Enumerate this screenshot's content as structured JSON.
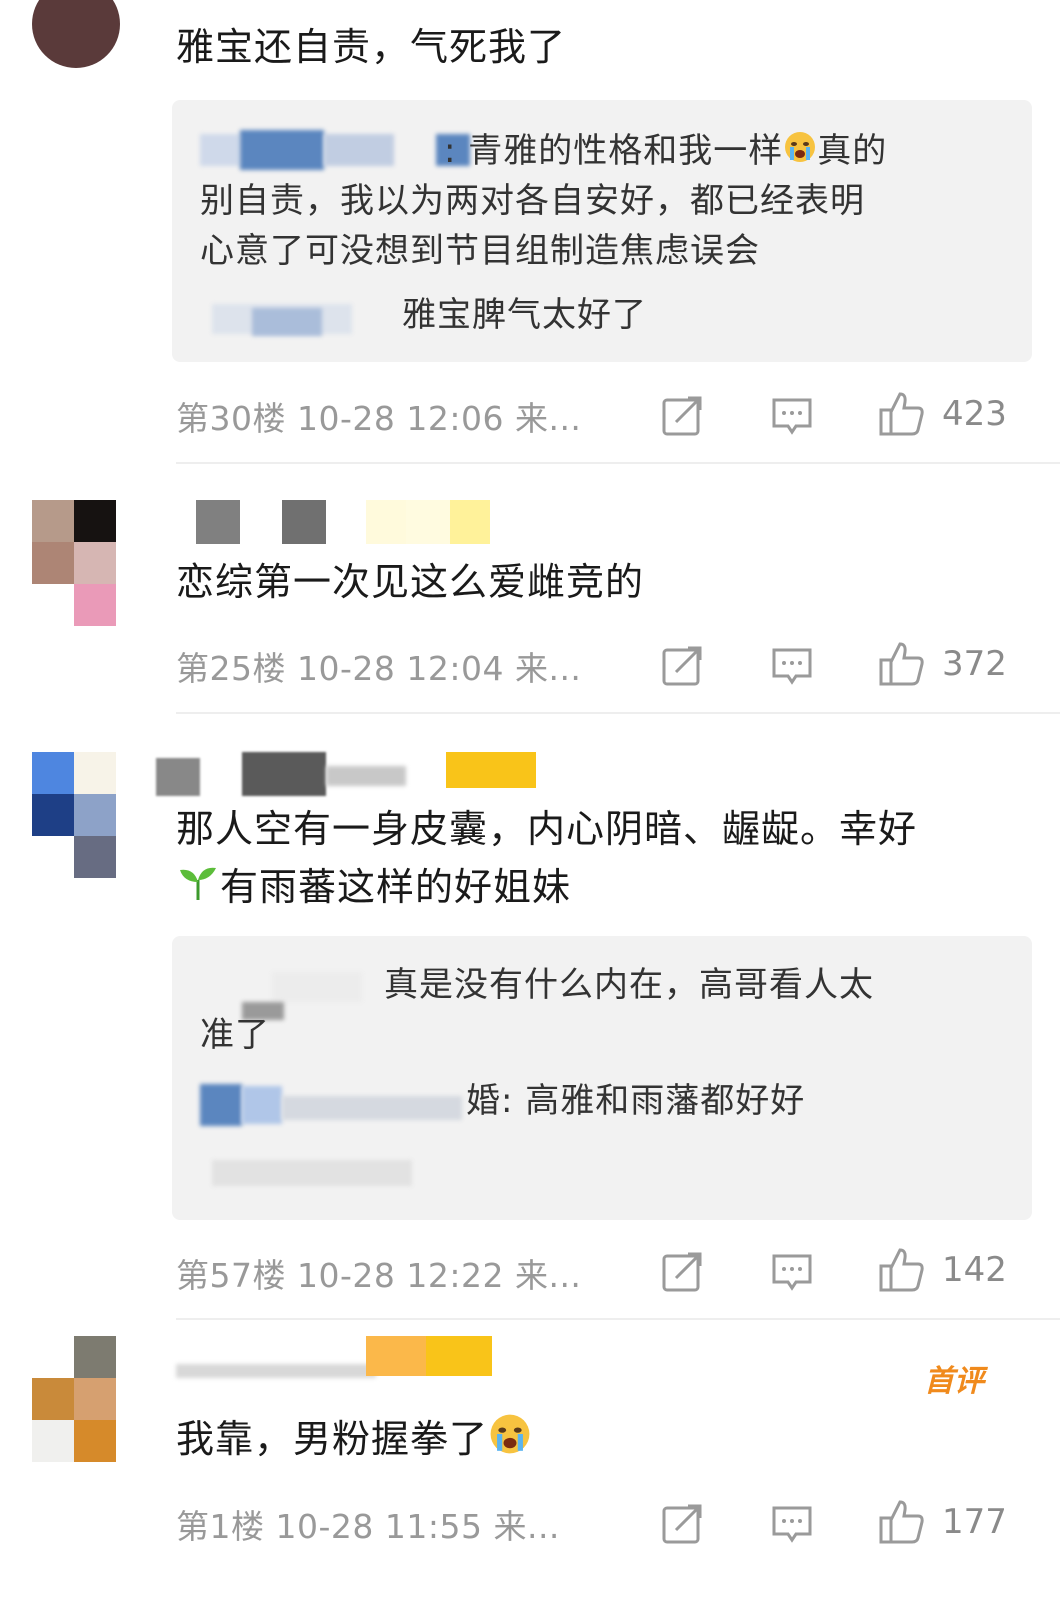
{
  "comments": [
    {
      "text": "雅宝还自责，气死我了",
      "replies": [
        {
          "sep": ":",
          "lines": [
            "青雅的性格和我一样",
            "别自责，我以为两对各自安好，都已经表明",
            "心意了可没想到节目组制造焦虑误会"
          ],
          "emoji_tail": "真的"
        },
        {
          "text": "雅宝脾气太好了"
        }
      ],
      "meta": "第30楼 10-28 12:06 来...",
      "likes": "423"
    },
    {
      "text": "恋综第一次见这么爱雌竞的",
      "meta": "第25楼 10-28 12:04 来...",
      "likes": "372"
    },
    {
      "text_line1": "那人空有一身皮囊，内心阴暗、龌龊。幸好",
      "text_line2": "有雨蕃这样的好姐妹",
      "replies": [
        {
          "lines": [
            "真是没有什么内在，高哥看人太",
            "准了"
          ]
        },
        {
          "prefix": "婚:",
          "text": "高雅和雨藩都好好"
        }
      ],
      "meta": "第57楼 10-28 12:22 来...",
      "likes": "142"
    },
    {
      "badge": "首评",
      "text": "我靠，男粉握拳了",
      "meta": "第1楼 10-28 11:55 来...",
      "likes": "177"
    }
  ],
  "icons": {
    "share": "share-icon",
    "comment": "comment-icon",
    "like": "thumbs-up-icon",
    "crying": "crying-emoji-icon",
    "seedling": "seedling-emoji-icon"
  },
  "colors": {
    "meta": "#999999",
    "reply_bg": "#f2f2f2",
    "badge": "#f08a1c"
  }
}
